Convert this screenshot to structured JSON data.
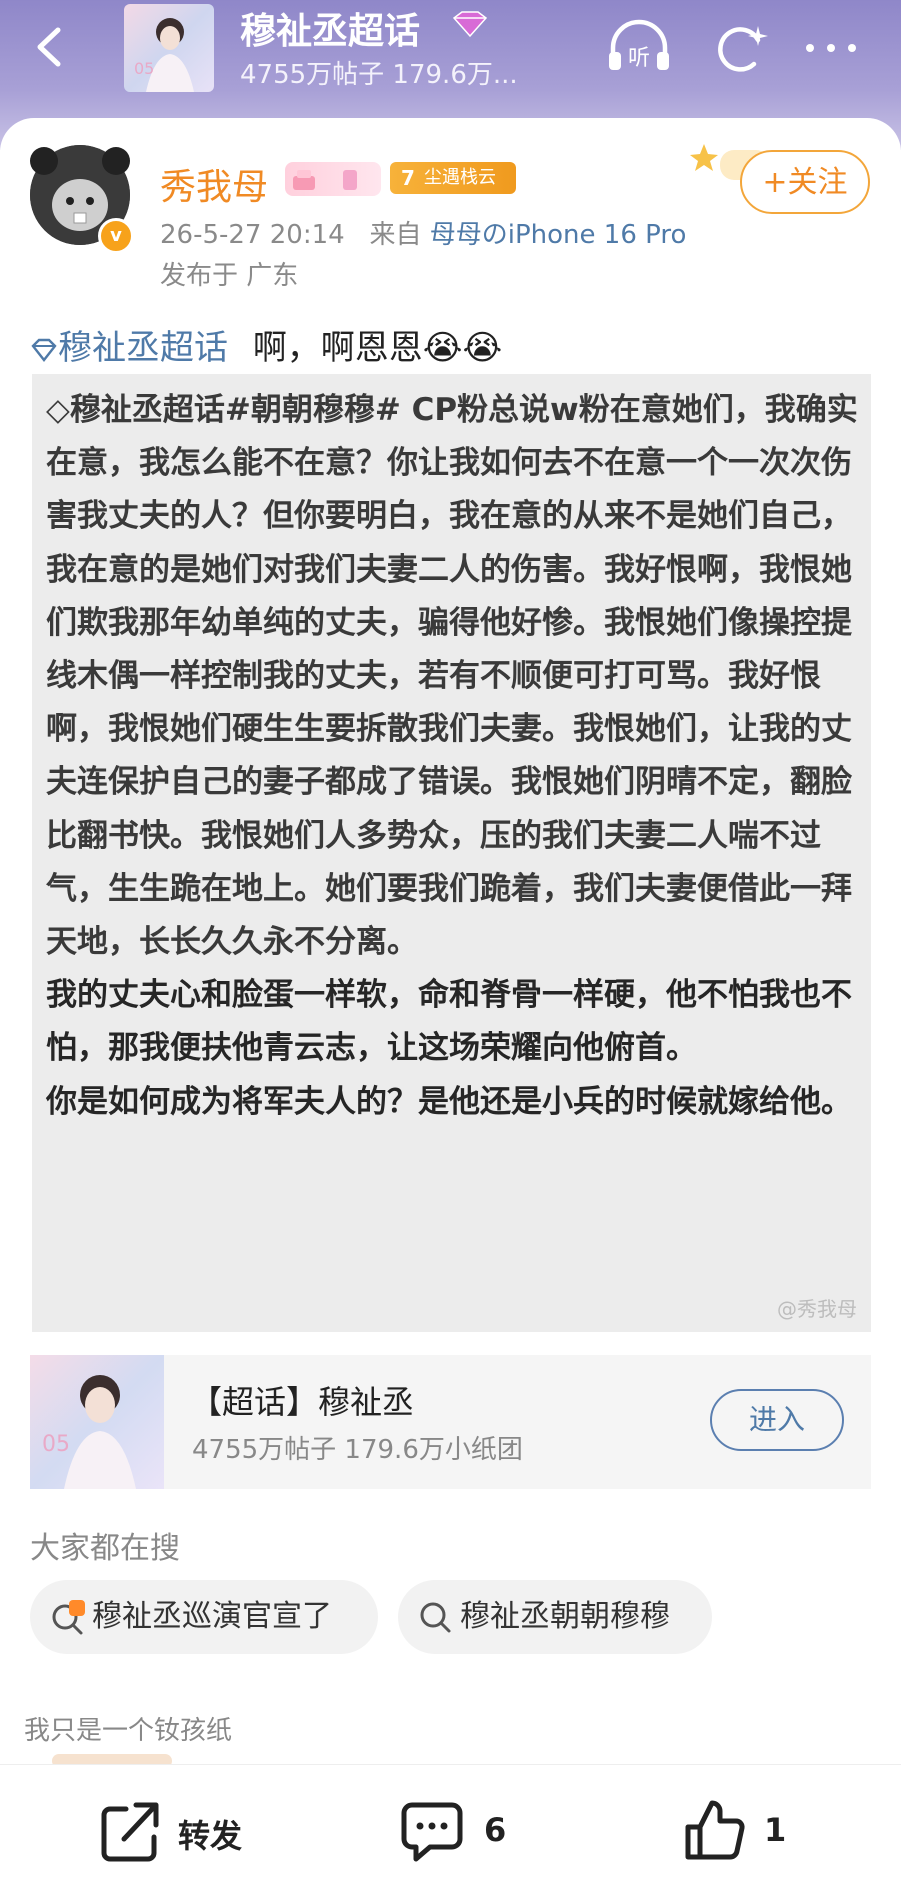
{
  "header": {
    "topic_title": "穆祉丞超话",
    "topic_stats": "4755万帖子 179.6万...",
    "icons": [
      "back-arrow-icon",
      "diamond-icon",
      "listen-icon",
      "refresh-icon",
      "more-icon"
    ],
    "listen_label": "听"
  },
  "post": {
    "author": "秀我母",
    "level": "7",
    "level_label": "尘遇栈云",
    "follow_label": "+关注",
    "time": "26-5-27 20:14",
    "source_prefix": "来自",
    "source": "母母のiPhone 16 Pro",
    "location": "发布于 广东",
    "topic_link": "穆祉丞超话",
    "text": "啊，啊恩恩😭😭",
    "image_text": [
      "◇穆祉丞超话#朝朝穆穆# CP粉总说w粉在意她们，我确实在意，我怎么能不在意？你让我如何去不在意一个一次次伤害我丈夫的人？但你要明白，我在意的从来不是她们自己，我在意的是她们对我们夫妻二人的伤害。我好恨啊，我恨她们欺我那年幼单纯的丈夫，骗得他好惨。我恨她们像操控提线木偶一样控制我的丈夫，若有不顺便可打可骂。我好恨啊，我恨她们硬生生要拆散我们夫妻。我恨她们，让我的丈夫连保护自己的妻子都成了错误。我恨她们阴晴不定，翻脸比翻书快。我恨她们人多势众，压的我们夫妻二人喘不过气，生生跪在地上。她们要我们跪着，我们夫妻便借此一拜天地，长长久久永不分离。",
      "我的丈夫心和脸蛋一样软，命和脊骨一样硬，他不怕我也不怕，那我便扶他青云志，让这场荣耀向他俯首。",
      "你是如何成为将军夫人的？是他还是小兵的时候就嫁给他。"
    ],
    "watermark": "@秀我母"
  },
  "topic_card": {
    "title": "【超话】穆祉丞",
    "stats": "4755万帖子 179.6万小纸团",
    "enter_label": "进入"
  },
  "search": {
    "heading": "大家都在搜",
    "items": [
      "穆祉丞巡演官宣了",
      "穆祉丞朝朝穆穆"
    ]
  },
  "comment_hint": "我只是一个钕孩纸",
  "actions": {
    "share_label": "转发",
    "comment_count": "6",
    "like_count": "1"
  },
  "colors": {
    "header_bg": "#9a92d0",
    "username": "#f08a24",
    "link": "#4f7aa8",
    "follow_border": "#f3a63a"
  }
}
